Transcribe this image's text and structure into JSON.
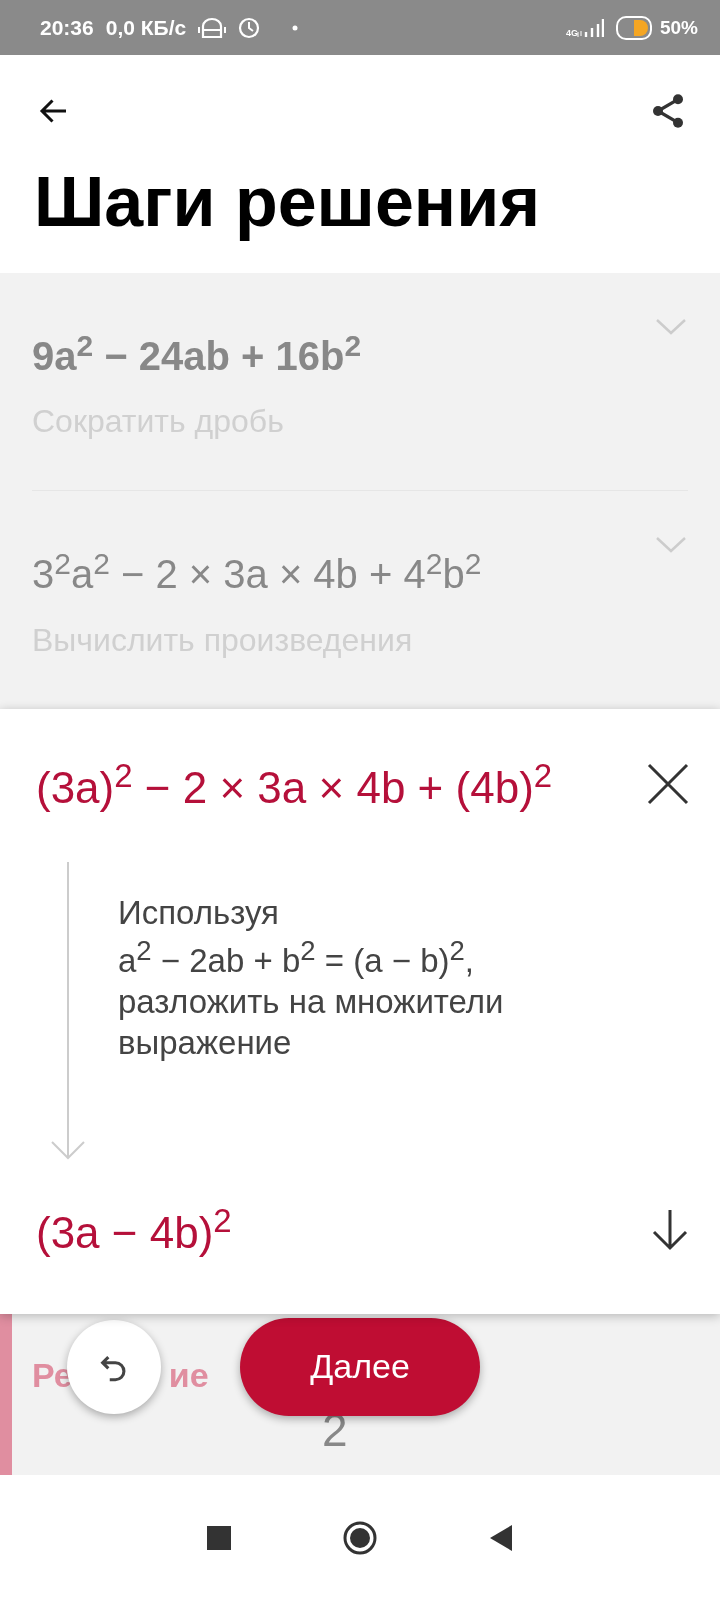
{
  "status_bar": {
    "time": "20:36",
    "speed": "0,0 КБ/с",
    "network": "4G",
    "battery": "50%"
  },
  "header": {
    "title": "Шаги решения"
  },
  "steps": [
    {
      "expression": "9a$^{2}$ − 24ab + 16b$^{2}$",
      "description": "Сократить дробь",
      "emphasis": true,
      "expanded": false
    },
    {
      "expression": "3$^{2}$a$^{2}$ − 2 × 3a × 4b + 4$^{2}$b$^{2}$",
      "description": "Вычислить произведения",
      "emphasis": false,
      "expanded": false
    }
  ],
  "active_step": {
    "expression": "(3a)$^{2}$ − 2 × 3a × 4b + (4b)$^{2}$",
    "explanation": "Используя\na$^{2}$ − 2ab + b$^{2}$ = (a − b)$^{2}$,\nразложить на множители\nвыражение",
    "result": "(3a − 4b)$^{2}$"
  },
  "solution": {
    "label_visible_start": "Ре",
    "label_visible_end": "ие",
    "expression_visible": "2"
  },
  "next_button": "Далее"
}
